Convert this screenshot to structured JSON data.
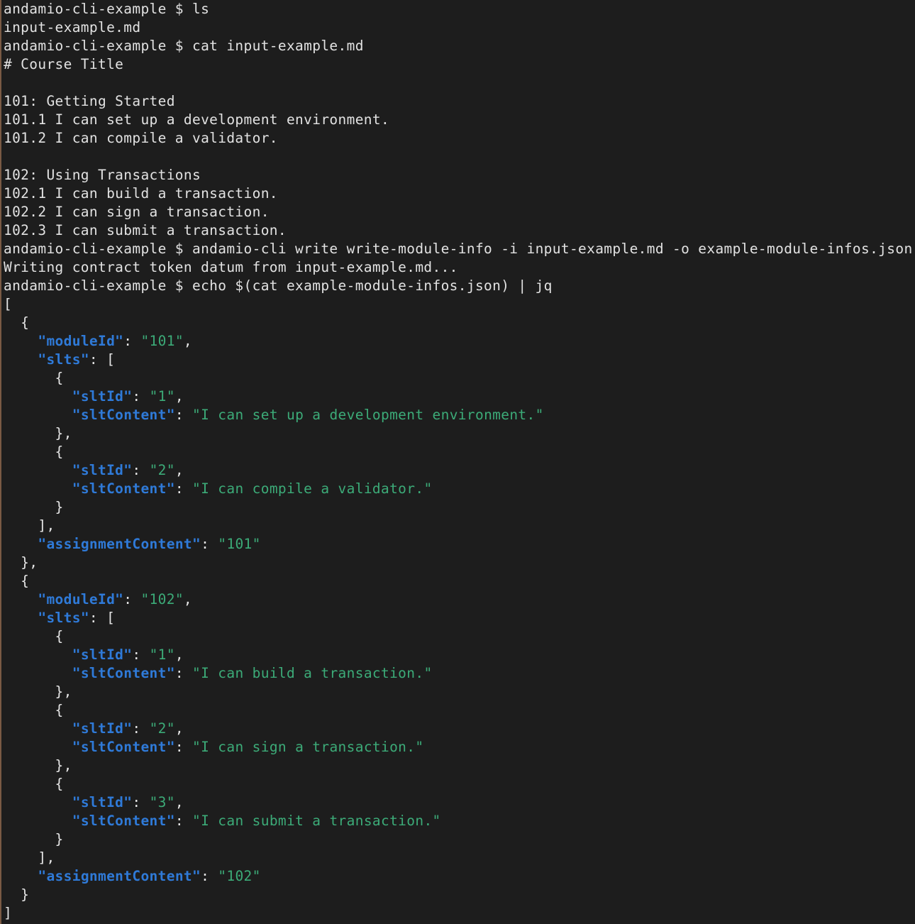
{
  "terminal": {
    "lines": [
      [
        {
          "t": "andamio-cli-example $ ls",
          "c": "prompt"
        }
      ],
      [
        {
          "t": "input-example.md",
          "c": "out"
        }
      ],
      [
        {
          "t": "andamio-cli-example $ cat input-example.md",
          "c": "prompt"
        }
      ],
      [
        {
          "t": "# Course Title",
          "c": "out"
        }
      ],
      [],
      [
        {
          "t": "101: Getting Started",
          "c": "out"
        }
      ],
      [
        {
          "t": "101.1 I can set up a development environment.",
          "c": "out"
        }
      ],
      [
        {
          "t": "101.2 I can compile a validator.",
          "c": "out"
        }
      ],
      [],
      [
        {
          "t": "102: Using Transactions",
          "c": "out"
        }
      ],
      [
        {
          "t": "102.1 I can build a transaction.",
          "c": "out"
        }
      ],
      [
        {
          "t": "102.2 I can sign a transaction.",
          "c": "out"
        }
      ],
      [
        {
          "t": "102.3 I can submit a transaction.",
          "c": "out"
        }
      ],
      [
        {
          "t": "andamio-cli-example $ andamio-cli write write-module-info -i input-example.md -o example-module-infos.json",
          "c": "prompt"
        }
      ],
      [
        {
          "t": "Writing contract token datum from input-example.md...",
          "c": "out"
        }
      ],
      [
        {
          "t": "andamio-cli-example $ echo $(cat example-module-infos.json) | jq",
          "c": "prompt"
        }
      ],
      [
        {
          "t": "[",
          "c": "punct"
        }
      ],
      [
        {
          "t": "  {",
          "c": "punct"
        }
      ],
      [
        {
          "t": "    ",
          "c": "punct"
        },
        {
          "t": "\"moduleId\"",
          "c": "key"
        },
        {
          "t": ": ",
          "c": "punct"
        },
        {
          "t": "\"101\"",
          "c": "str"
        },
        {
          "t": ",",
          "c": "punct"
        }
      ],
      [
        {
          "t": "    ",
          "c": "punct"
        },
        {
          "t": "\"slts\"",
          "c": "key"
        },
        {
          "t": ": [",
          "c": "punct"
        }
      ],
      [
        {
          "t": "      {",
          "c": "punct"
        }
      ],
      [
        {
          "t": "        ",
          "c": "punct"
        },
        {
          "t": "\"sltId\"",
          "c": "key"
        },
        {
          "t": ": ",
          "c": "punct"
        },
        {
          "t": "\"1\"",
          "c": "str"
        },
        {
          "t": ",",
          "c": "punct"
        }
      ],
      [
        {
          "t": "        ",
          "c": "punct"
        },
        {
          "t": "\"sltContent\"",
          "c": "key"
        },
        {
          "t": ": ",
          "c": "punct"
        },
        {
          "t": "\"I can set up a development environment.\"",
          "c": "str"
        }
      ],
      [
        {
          "t": "      },",
          "c": "punct"
        }
      ],
      [
        {
          "t": "      {",
          "c": "punct"
        }
      ],
      [
        {
          "t": "        ",
          "c": "punct"
        },
        {
          "t": "\"sltId\"",
          "c": "key"
        },
        {
          "t": ": ",
          "c": "punct"
        },
        {
          "t": "\"2\"",
          "c": "str"
        },
        {
          "t": ",",
          "c": "punct"
        }
      ],
      [
        {
          "t": "        ",
          "c": "punct"
        },
        {
          "t": "\"sltContent\"",
          "c": "key"
        },
        {
          "t": ": ",
          "c": "punct"
        },
        {
          "t": "\"I can compile a validator.\"",
          "c": "str"
        }
      ],
      [
        {
          "t": "      }",
          "c": "punct"
        }
      ],
      [
        {
          "t": "    ],",
          "c": "punct"
        }
      ],
      [
        {
          "t": "    ",
          "c": "punct"
        },
        {
          "t": "\"assignmentContent\"",
          "c": "key"
        },
        {
          "t": ": ",
          "c": "punct"
        },
        {
          "t": "\"101\"",
          "c": "str"
        }
      ],
      [
        {
          "t": "  },",
          "c": "punct"
        }
      ],
      [
        {
          "t": "  {",
          "c": "punct"
        }
      ],
      [
        {
          "t": "    ",
          "c": "punct"
        },
        {
          "t": "\"moduleId\"",
          "c": "key"
        },
        {
          "t": ": ",
          "c": "punct"
        },
        {
          "t": "\"102\"",
          "c": "str"
        },
        {
          "t": ",",
          "c": "punct"
        }
      ],
      [
        {
          "t": "    ",
          "c": "punct"
        },
        {
          "t": "\"slts\"",
          "c": "key"
        },
        {
          "t": ": [",
          "c": "punct"
        }
      ],
      [
        {
          "t": "      {",
          "c": "punct"
        }
      ],
      [
        {
          "t": "        ",
          "c": "punct"
        },
        {
          "t": "\"sltId\"",
          "c": "key"
        },
        {
          "t": ": ",
          "c": "punct"
        },
        {
          "t": "\"1\"",
          "c": "str"
        },
        {
          "t": ",",
          "c": "punct"
        }
      ],
      [
        {
          "t": "        ",
          "c": "punct"
        },
        {
          "t": "\"sltContent\"",
          "c": "key"
        },
        {
          "t": ": ",
          "c": "punct"
        },
        {
          "t": "\"I can build a transaction.\"",
          "c": "str"
        }
      ],
      [
        {
          "t": "      },",
          "c": "punct"
        }
      ],
      [
        {
          "t": "      {",
          "c": "punct"
        }
      ],
      [
        {
          "t": "        ",
          "c": "punct"
        },
        {
          "t": "\"sltId\"",
          "c": "key"
        },
        {
          "t": ": ",
          "c": "punct"
        },
        {
          "t": "\"2\"",
          "c": "str"
        },
        {
          "t": ",",
          "c": "punct"
        }
      ],
      [
        {
          "t": "        ",
          "c": "punct"
        },
        {
          "t": "\"sltContent\"",
          "c": "key"
        },
        {
          "t": ": ",
          "c": "punct"
        },
        {
          "t": "\"I can sign a transaction.\"",
          "c": "str"
        }
      ],
      [
        {
          "t": "      },",
          "c": "punct"
        }
      ],
      [
        {
          "t": "      {",
          "c": "punct"
        }
      ],
      [
        {
          "t": "        ",
          "c": "punct"
        },
        {
          "t": "\"sltId\"",
          "c": "key"
        },
        {
          "t": ": ",
          "c": "punct"
        },
        {
          "t": "\"3\"",
          "c": "str"
        },
        {
          "t": ",",
          "c": "punct"
        }
      ],
      [
        {
          "t": "        ",
          "c": "punct"
        },
        {
          "t": "\"sltContent\"",
          "c": "key"
        },
        {
          "t": ": ",
          "c": "punct"
        },
        {
          "t": "\"I can submit a transaction.\"",
          "c": "str"
        }
      ],
      [
        {
          "t": "      }",
          "c": "punct"
        }
      ],
      [
        {
          "t": "    ],",
          "c": "punct"
        }
      ],
      [
        {
          "t": "    ",
          "c": "punct"
        },
        {
          "t": "\"assignmentContent\"",
          "c": "key"
        },
        {
          "t": ": ",
          "c": "punct"
        },
        {
          "t": "\"102\"",
          "c": "str"
        }
      ],
      [
        {
          "t": "  }",
          "c": "punct"
        }
      ],
      [
        {
          "t": "]",
          "c": "punct"
        }
      ]
    ]
  },
  "colors": {
    "background": "#1d1d1d",
    "text": "#e2e2e2",
    "json_key": "#2f7ad8",
    "json_string": "#3cab78"
  }
}
